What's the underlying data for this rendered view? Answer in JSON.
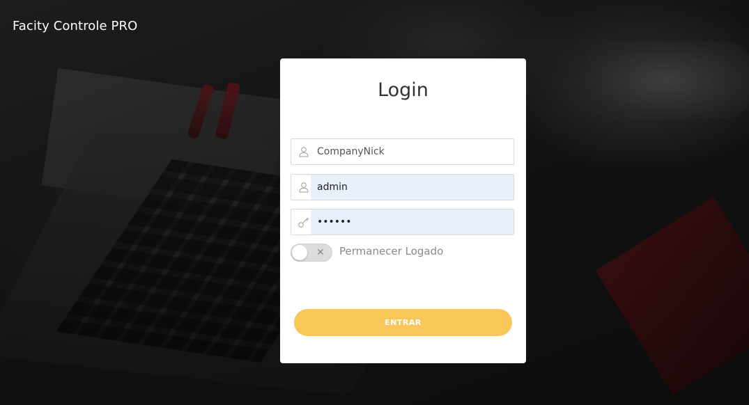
{
  "app": {
    "title": "Facity Controle PRO"
  },
  "login": {
    "heading": "Login",
    "company_value": "CompanyNick",
    "username_value": "admin",
    "password_value": "••••••",
    "remember_label": "Permanecer Logado",
    "remember_toggle_symbol": "✕",
    "remember_checked": false,
    "submit_label": "ENTRAR"
  },
  "icons": {
    "company": "user-icon",
    "username": "user-icon",
    "password": "key-icon",
    "toggle_off": "close-icon"
  },
  "colors": {
    "button": "#f9c65a",
    "autofill": "#e8f0fe",
    "card": "#ffffff"
  }
}
